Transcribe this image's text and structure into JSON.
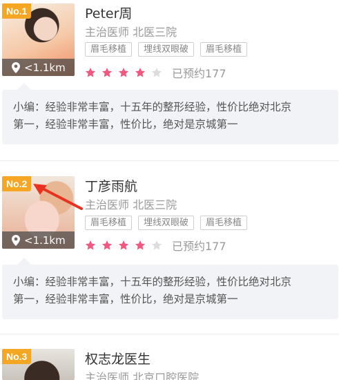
{
  "doctors": [
    {
      "rank": "No.1",
      "name": "Peter周",
      "title": "主治医师  北医三院",
      "distance": "<1.1km",
      "tags": [
        "眉毛移植",
        "埋线双眼破",
        "眉毛移植"
      ],
      "rating": 4,
      "rating_max": 5,
      "booked": "已预约177",
      "note": [
        "小编：经验非常丰富，十五年的整形经验，性价比绝对北京",
        "第一，经验非常丰富，性价比，绝对是京城第一"
      ]
    },
    {
      "rank": "No.2",
      "name": "丁彦雨航",
      "title": "主治医师 北医三院",
      "distance": "<1.1km",
      "tags": [
        "眉毛移植",
        "埋线双眼破",
        "眉毛移植"
      ],
      "rating": 4,
      "rating_max": 5,
      "booked": "已预约177",
      "note": [
        "小编：经验非常丰富，十五年的整形经验，性价比绝对北京",
        "第一，经验非常丰富，性价比，绝对是京城第一"
      ]
    },
    {
      "rank": "No.3",
      "name": "权志龙医生",
      "title": "主治医师  北京口腔医院"
    }
  ],
  "colors": {
    "rank_badge": "#f5a623",
    "star_on": "#f2577d",
    "star_off": "#dcdcdc",
    "annotation_arrow": "#e8321f"
  },
  "icons": {
    "location": "location-pin-icon",
    "star": "star-icon"
  }
}
